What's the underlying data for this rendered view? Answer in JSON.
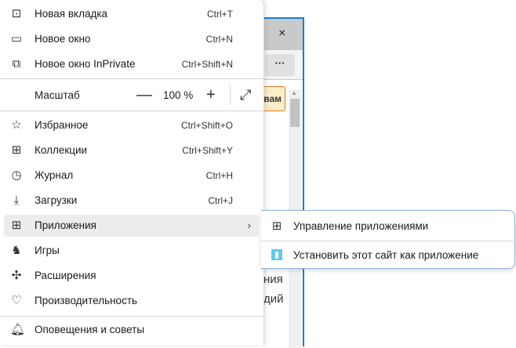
{
  "background": {
    "close_glyph": "×",
    "more_glyph": "···",
    "button_text": "вам",
    "text_line1": "ния",
    "text_line2": "дий"
  },
  "menu": {
    "items": [
      {
        "label": "Новая вкладка",
        "shortcut": "Ctrl+T",
        "icon": "new-tab-icon"
      },
      {
        "label": "Новое окно",
        "shortcut": "Ctrl+N",
        "icon": "new-window-icon"
      },
      {
        "label": "Новое окно InPrivate",
        "shortcut": "Ctrl+Shift+N",
        "icon": "inprivate-icon"
      },
      {
        "label": "Избранное",
        "shortcut": "Ctrl+Shift+O",
        "icon": "favorites-icon"
      },
      {
        "label": "Коллекции",
        "shortcut": "Ctrl+Shift+Y",
        "icon": "collections-icon"
      },
      {
        "label": "Журнал",
        "shortcut": "Ctrl+H",
        "icon": "history-icon"
      },
      {
        "label": "Загрузки",
        "shortcut": "Ctrl+J",
        "icon": "downloads-icon"
      },
      {
        "label": "Приложения",
        "shortcut": "",
        "icon": "apps-icon",
        "has_submenu": true,
        "highlighted": true
      },
      {
        "label": "Игры",
        "shortcut": "",
        "icon": "games-icon"
      },
      {
        "label": "Расширения",
        "shortcut": "",
        "icon": "extensions-icon"
      },
      {
        "label": "Производительность",
        "shortcut": "",
        "icon": "performance-icon"
      },
      {
        "label": "Оповещения и советы",
        "shortcut": "",
        "icon": "bell-icon"
      }
    ],
    "zoom": {
      "label": "Масштаб",
      "value": "100 %",
      "minus": "—",
      "plus": "+",
      "fullscreen": "⤢"
    }
  },
  "submenu": {
    "items": [
      {
        "label": "Управление приложениями",
        "icon": "apps-icon"
      },
      {
        "label": "Установить этот сайт как приложение",
        "icon": "site-app-icon"
      }
    ]
  }
}
